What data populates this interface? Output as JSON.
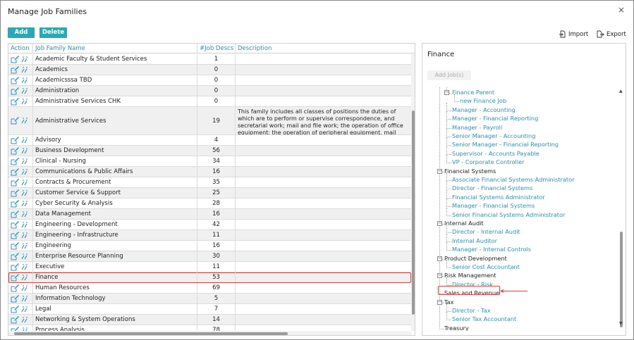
{
  "window": {
    "title": "Manage Job Families",
    "close_glyph": "×"
  },
  "toolbar": {
    "add_label": "Add",
    "delete_label": "Delete",
    "import_label": "Import",
    "export_label": "Export"
  },
  "grid": {
    "headers": {
      "action": "Action",
      "name": "Job Family Name",
      "count": "#Job Descs",
      "description": "Description"
    },
    "rows": [
      {
        "name": "Academic Faculty & Student Services",
        "count": "1",
        "desc": ""
      },
      {
        "name": "Academics",
        "count": "0",
        "desc": ""
      },
      {
        "name": "Academicsssa TBD",
        "count": "0",
        "desc": ""
      },
      {
        "name": "Administration",
        "count": "0",
        "desc": ""
      },
      {
        "name": "Administrative Services CHK",
        "count": "0",
        "desc": ""
      },
      {
        "name": "Administrative Services",
        "count": "19",
        "desc": "This family includes all classes of positions the duties of which are to perform or supervise correspondence, and secretarial work; mail and file work; the operation of office equipment; the operation of peripheral equipment, mail processing equipment, duplicating equipment, and administrative nature."
      },
      {
        "name": "Advisory",
        "count": "4",
        "desc": ""
      },
      {
        "name": "Business Development",
        "count": "56",
        "desc": ""
      },
      {
        "name": "Clinical - Nursing",
        "count": "34",
        "desc": ""
      },
      {
        "name": "Communications & Public Affairs",
        "count": "16",
        "desc": ""
      },
      {
        "name": "Contracts & Procurement",
        "count": "35",
        "desc": ""
      },
      {
        "name": "Customer Service & Support",
        "count": "25",
        "desc": ""
      },
      {
        "name": "Cyber Security & Analysis",
        "count": "28",
        "desc": ""
      },
      {
        "name": "Data Management",
        "count": "16",
        "desc": ""
      },
      {
        "name": "Engineering - Development",
        "count": "42",
        "desc": ""
      },
      {
        "name": "Engineering - Infrastructure",
        "count": "11",
        "desc": ""
      },
      {
        "name": "Engineering",
        "count": "16",
        "desc": ""
      },
      {
        "name": "Enterprise Resource Planning",
        "count": "30",
        "desc": ""
      },
      {
        "name": "Executive",
        "count": "11",
        "desc": ""
      },
      {
        "name": "Finance",
        "count": "53",
        "desc": ""
      },
      {
        "name": "Human Resources",
        "count": "69",
        "desc": ""
      },
      {
        "name": "Information Technology",
        "count": "5",
        "desc": ""
      },
      {
        "name": "Legal",
        "count": "7",
        "desc": ""
      },
      {
        "name": "Networking & System Operations",
        "count": "14",
        "desc": ""
      },
      {
        "name": "Process Analysis",
        "count": "78",
        "desc": ""
      }
    ],
    "selected_row": "Finance"
  },
  "panel": {
    "title": "Finance",
    "add_job_label": "Add Job(s)",
    "tree": [
      {
        "text": "Finance Parent",
        "level": 1,
        "kind": "group-link"
      },
      {
        "text": "new Finance Job",
        "level": 2,
        "kind": "job"
      },
      {
        "text": "Manager - Accounting",
        "level": 1,
        "kind": "job"
      },
      {
        "text": "Manager - Financial Reporting",
        "level": 1,
        "kind": "job"
      },
      {
        "text": "Manager - Payroll",
        "level": 1,
        "kind": "job"
      },
      {
        "text": "Senior Manager - Accounting",
        "level": 1,
        "kind": "job"
      },
      {
        "text": "Senior Manager - Financial Reporting",
        "level": 1,
        "kind": "job"
      },
      {
        "text": "Supervisor - Accounts Payable",
        "level": 1,
        "kind": "job"
      },
      {
        "text": "VP - Corporate Controller",
        "level": 1,
        "kind": "job"
      },
      {
        "text": "Financial Systems",
        "level": 0,
        "kind": "group"
      },
      {
        "text": "Associate Financial Systems Administrator",
        "level": 1,
        "kind": "job"
      },
      {
        "text": "Director - Financial Systems",
        "level": 1,
        "kind": "job"
      },
      {
        "text": "Financial Systems Administrator",
        "level": 1,
        "kind": "job"
      },
      {
        "text": "Manager - Financial Systems",
        "level": 1,
        "kind": "job"
      },
      {
        "text": "Senior Financial Systems Administrator",
        "level": 1,
        "kind": "job"
      },
      {
        "text": "Internal Audit",
        "level": 0,
        "kind": "group"
      },
      {
        "text": "Director - Internal Audit",
        "level": 1,
        "kind": "job"
      },
      {
        "text": "Internal Auditor",
        "level": 1,
        "kind": "job"
      },
      {
        "text": "Manager - Internal Controls",
        "level": 1,
        "kind": "job"
      },
      {
        "text": "Product Development",
        "level": 0,
        "kind": "group"
      },
      {
        "text": "Senior Cost Accountant",
        "level": 1,
        "kind": "job"
      },
      {
        "text": "Risk Management",
        "level": 0,
        "kind": "group"
      },
      {
        "text": "Director - Risk",
        "level": 1,
        "kind": "job"
      },
      {
        "text": "Sales and Revenue",
        "level": 0,
        "kind": "group-leaf"
      },
      {
        "text": "Tax",
        "level": 0,
        "kind": "group"
      },
      {
        "text": "Director - Tax",
        "level": 1,
        "kind": "job"
      },
      {
        "text": "Senior Tax Accountant",
        "level": 1,
        "kind": "job"
      },
      {
        "text": "Treasury",
        "level": 0,
        "kind": "group-leaf"
      }
    ]
  },
  "colors": {
    "accent": "#2aa8b5",
    "link": "#2a94b4",
    "highlight": "#e53a3a"
  },
  "icons": {
    "row_edit": "edit-icon",
    "row_jobs": "jobs-icon",
    "import": "import-icon",
    "export": "export-icon"
  }
}
